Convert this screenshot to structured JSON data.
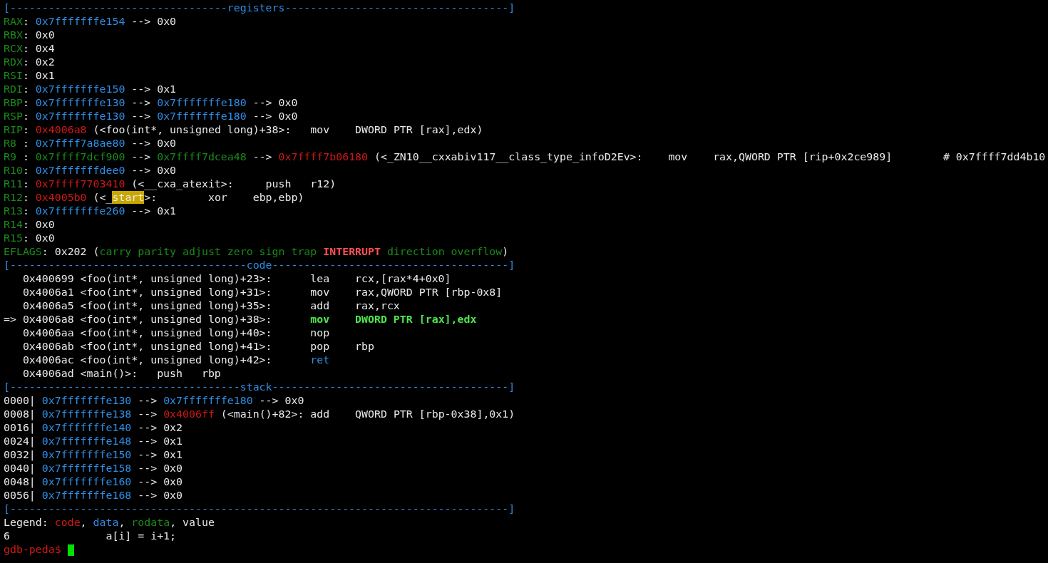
{
  "terminal": {
    "lines": [
      {
        "segments": [
          {
            "text": "[----------------------------------registers-----------------------------------]",
            "kind": "header"
          }
        ]
      },
      {
        "segments": [
          {
            "text": "RAX",
            "kind": "register"
          },
          {
            "text": ": ",
            "kind": "plain"
          },
          {
            "text": "0x7fffffffe154",
            "kind": "data"
          },
          {
            "text": " --> 0x0",
            "kind": "plain"
          }
        ]
      },
      {
        "segments": [
          {
            "text": "RBX",
            "kind": "register"
          },
          {
            "text": ": 0x0",
            "kind": "plain"
          }
        ]
      },
      {
        "segments": [
          {
            "text": "RCX",
            "kind": "register"
          },
          {
            "text": ": 0x4",
            "kind": "plain"
          }
        ]
      },
      {
        "segments": [
          {
            "text": "RDX",
            "kind": "register"
          },
          {
            "text": ": 0x2",
            "kind": "plain"
          }
        ]
      },
      {
        "segments": [
          {
            "text": "RSI",
            "kind": "register"
          },
          {
            "text": ": 0x1",
            "kind": "plain"
          }
        ]
      },
      {
        "segments": [
          {
            "text": "RDI",
            "kind": "register"
          },
          {
            "text": ": ",
            "kind": "plain"
          },
          {
            "text": "0x7fffffffe150",
            "kind": "data"
          },
          {
            "text": " --> 0x1",
            "kind": "plain"
          }
        ]
      },
      {
        "segments": [
          {
            "text": "RBP",
            "kind": "register"
          },
          {
            "text": ": ",
            "kind": "plain"
          },
          {
            "text": "0x7fffffffe130",
            "kind": "data"
          },
          {
            "text": " --> ",
            "kind": "plain"
          },
          {
            "text": "0x7fffffffe180",
            "kind": "data"
          },
          {
            "text": " --> 0x0",
            "kind": "plain"
          }
        ]
      },
      {
        "segments": [
          {
            "text": "RSP",
            "kind": "register"
          },
          {
            "text": ": ",
            "kind": "plain"
          },
          {
            "text": "0x7fffffffe130",
            "kind": "data"
          },
          {
            "text": " --> ",
            "kind": "plain"
          },
          {
            "text": "0x7fffffffe180",
            "kind": "data"
          },
          {
            "text": " --> 0x0",
            "kind": "plain"
          }
        ]
      },
      {
        "segments": [
          {
            "text": "RIP",
            "kind": "register"
          },
          {
            "text": ": ",
            "kind": "plain"
          },
          {
            "text": "0x4006a8",
            "kind": "code"
          },
          {
            "text": " (<foo(int*, unsigned long)+38>:   mov    DWORD PTR [rax],edx)",
            "kind": "plain"
          }
        ]
      },
      {
        "segments": [
          {
            "text": "R8 ",
            "kind": "register"
          },
          {
            "text": ": ",
            "kind": "plain"
          },
          {
            "text": "0x7ffff7a8ae80",
            "kind": "data"
          },
          {
            "text": " --> 0x0",
            "kind": "plain"
          }
        ]
      },
      {
        "segments": [
          {
            "text": "R9 ",
            "kind": "register"
          },
          {
            "text": ": ",
            "kind": "plain"
          },
          {
            "text": "0x7ffff7dcf900",
            "kind": "rodata"
          },
          {
            "text": " --> ",
            "kind": "plain"
          },
          {
            "text": "0x7ffff7dcea48",
            "kind": "rodata"
          },
          {
            "text": " --> ",
            "kind": "plain"
          },
          {
            "text": "0x7ffff7b06180",
            "kind": "code"
          },
          {
            "text": " (<_ZN10__cxxabiv117__class_type_infoD2Ev>:    mov    rax,QWORD PTR [rip+0x2ce989]        # 0x7ffff7dd4b10",
            "kind": "plain"
          }
        ]
      },
      {
        "segments": [
          {
            "text": "R10",
            "kind": "register"
          },
          {
            "text": ": ",
            "kind": "plain"
          },
          {
            "text": "0x7fffffffdee0",
            "kind": "data"
          },
          {
            "text": " --> 0x0",
            "kind": "plain"
          }
        ]
      },
      {
        "segments": [
          {
            "text": "R11",
            "kind": "register"
          },
          {
            "text": ": ",
            "kind": "plain"
          },
          {
            "text": "0x7ffff7703410",
            "kind": "code"
          },
          {
            "text": " (<__cxa_atexit>:     push   r12)",
            "kind": "plain"
          }
        ]
      },
      {
        "segments": [
          {
            "text": "R12",
            "kind": "register"
          },
          {
            "text": ": ",
            "kind": "plain"
          },
          {
            "text": "0x4005b0",
            "kind": "code"
          },
          {
            "text": " (<_",
            "kind": "plain"
          },
          {
            "text": "start",
            "kind": "highlight"
          },
          {
            "text": ">:        xor    ebp,ebp)",
            "kind": "plain"
          }
        ]
      },
      {
        "segments": [
          {
            "text": "R13",
            "kind": "register"
          },
          {
            "text": ": ",
            "kind": "plain"
          },
          {
            "text": "0x7fffffffe260",
            "kind": "data"
          },
          {
            "text": " --> 0x1",
            "kind": "plain"
          }
        ]
      },
      {
        "segments": [
          {
            "text": "R14",
            "kind": "register"
          },
          {
            "text": ": 0x0",
            "kind": "plain"
          }
        ]
      },
      {
        "segments": [
          {
            "text": "R15",
            "kind": "register"
          },
          {
            "text": ": 0x0",
            "kind": "plain"
          }
        ]
      },
      {
        "segments": [
          {
            "text": "EFLAGS",
            "kind": "register"
          },
          {
            "text": ": 0x202 (",
            "kind": "plain"
          },
          {
            "text": "carry parity adjust zero sign trap ",
            "kind": "rodata"
          },
          {
            "text": "INTERRUPT",
            "kind": "flag-set"
          },
          {
            "text": " direction overflow",
            "kind": "rodata"
          },
          {
            "text": ")",
            "kind": "plain"
          }
        ]
      },
      {
        "segments": [
          {
            "text": "[-------------------------------------code-------------------------------------]",
            "kind": "header"
          }
        ]
      },
      {
        "segments": [
          {
            "text": "   0x400699 <foo(int*, unsigned long)+23>:      lea    rcx,[rax*4+0x0]",
            "kind": "plain"
          }
        ]
      },
      {
        "segments": [
          {
            "text": "   0x4006a1 <foo(int*, unsigned long)+31>:      mov    rax,QWORD PTR [rbp-0x8]",
            "kind": "plain"
          }
        ]
      },
      {
        "segments": [
          {
            "text": "   0x4006a5 <foo(int*, unsigned long)+35>:      add    rax,rcx",
            "kind": "plain"
          }
        ]
      },
      {
        "segments": [
          {
            "text": "=> 0x4006a8 <foo(int*, unsigned long)+38>:      ",
            "kind": "plain"
          },
          {
            "text": "mov    DWORD PTR [rax],edx",
            "kind": "current"
          }
        ]
      },
      {
        "segments": [
          {
            "text": "   0x4006aa <foo(int*, unsigned long)+40>:      nop",
            "kind": "plain"
          }
        ]
      },
      {
        "segments": [
          {
            "text": "   0x4006ab <foo(int*, unsigned long)+41>:      pop    rbp",
            "kind": "plain"
          }
        ]
      },
      {
        "segments": [
          {
            "text": "   0x4006ac <foo(int*, unsigned long)+42>:      ",
            "kind": "plain"
          },
          {
            "text": "ret",
            "kind": "data"
          }
        ]
      },
      {
        "segments": [
          {
            "text": "   0x4006ad <main()>:   push   rbp",
            "kind": "plain"
          }
        ]
      },
      {
        "segments": [
          {
            "text": "[------------------------------------stack-------------------------------------]",
            "kind": "header"
          }
        ]
      },
      {
        "segments": [
          {
            "text": "0000| ",
            "kind": "plain"
          },
          {
            "text": "0x7fffffffe130",
            "kind": "data"
          },
          {
            "text": " --> ",
            "kind": "plain"
          },
          {
            "text": "0x7fffffffe180",
            "kind": "data"
          },
          {
            "text": " --> 0x0",
            "kind": "plain"
          }
        ]
      },
      {
        "segments": [
          {
            "text": "0008| ",
            "kind": "plain"
          },
          {
            "text": "0x7fffffffe138",
            "kind": "data"
          },
          {
            "text": " --> ",
            "kind": "plain"
          },
          {
            "text": "0x4006ff",
            "kind": "code"
          },
          {
            "text": " (<main()+82>: add    QWORD PTR [rbp-0x38],0x1)",
            "kind": "plain"
          }
        ]
      },
      {
        "segments": [
          {
            "text": "0016| ",
            "kind": "plain"
          },
          {
            "text": "0x7fffffffe140",
            "kind": "data"
          },
          {
            "text": " --> 0x2",
            "kind": "plain"
          }
        ]
      },
      {
        "segments": [
          {
            "text": "0024| ",
            "kind": "plain"
          },
          {
            "text": "0x7fffffffe148",
            "kind": "data"
          },
          {
            "text": " --> 0x1",
            "kind": "plain"
          }
        ]
      },
      {
        "segments": [
          {
            "text": "0032| ",
            "kind": "plain"
          },
          {
            "text": "0x7fffffffe150",
            "kind": "data"
          },
          {
            "text": " --> 0x1",
            "kind": "plain"
          }
        ]
      },
      {
        "segments": [
          {
            "text": "0040| ",
            "kind": "plain"
          },
          {
            "text": "0x7fffffffe158",
            "kind": "data"
          },
          {
            "text": " --> 0x0",
            "kind": "plain"
          }
        ]
      },
      {
        "segments": [
          {
            "text": "0048| ",
            "kind": "plain"
          },
          {
            "text": "0x7fffffffe160",
            "kind": "data"
          },
          {
            "text": " --> 0x0",
            "kind": "plain"
          }
        ]
      },
      {
        "segments": [
          {
            "text": "0056| ",
            "kind": "plain"
          },
          {
            "text": "0x7fffffffe168",
            "kind": "data"
          },
          {
            "text": " --> 0x0",
            "kind": "plain"
          }
        ]
      },
      {
        "segments": [
          {
            "text": "[------------------------------------------------------------------------------]",
            "kind": "header"
          }
        ]
      },
      {
        "segments": [
          {
            "text": "Legend: ",
            "kind": "plain"
          },
          {
            "text": "code",
            "kind": "code"
          },
          {
            "text": ", ",
            "kind": "plain"
          },
          {
            "text": "data",
            "kind": "data"
          },
          {
            "text": ", ",
            "kind": "plain"
          },
          {
            "text": "rodata",
            "kind": "rodata"
          },
          {
            "text": ", value",
            "kind": "plain"
          }
        ]
      },
      {
        "segments": [
          {
            "text": "6               a[i] = i+1;",
            "kind": "plain"
          }
        ]
      }
    ],
    "prompt": "gdb-peda$"
  }
}
